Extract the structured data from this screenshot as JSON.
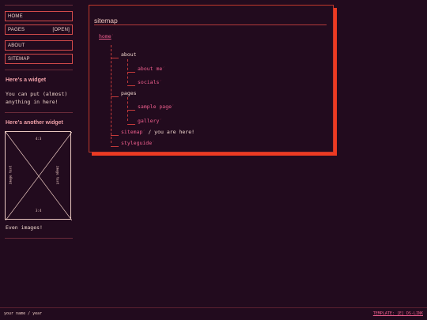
{
  "nav": {
    "home": "HOME",
    "pages": "PAGES",
    "pages_state": "[OPEN]",
    "about": "ABOUT",
    "sitemap": "SITEMAP"
  },
  "widgets": [
    {
      "title": "Here's a widget",
      "text": "You can put (almost) anything in here!"
    },
    {
      "title": "Here's another widget",
      "image": {
        "ratio": "4:3",
        "ratio_bottom": "3:4",
        "side_left": "image text",
        "side_right": "image text"
      },
      "caption": "Even images!"
    }
  ],
  "main": {
    "title": "sitemap",
    "tree": {
      "home": "home",
      "about": "about",
      "about_me": "about me",
      "socials": "socials",
      "pages": "pages",
      "sample_page": "sample page",
      "gallery": "gallery",
      "sitemap": "sitemap",
      "sitemap_note": "/ you are here!",
      "styleguide": "styleguide",
      "tick": "´"
    }
  },
  "footer": {
    "left": "your name / year",
    "right": "TEMPLATE: [E] DS-LINK"
  },
  "colors": {
    "background": "#220b1e",
    "accent": "#ee3a22",
    "link": "#ef5f8e",
    "border": "#d24a4a"
  }
}
